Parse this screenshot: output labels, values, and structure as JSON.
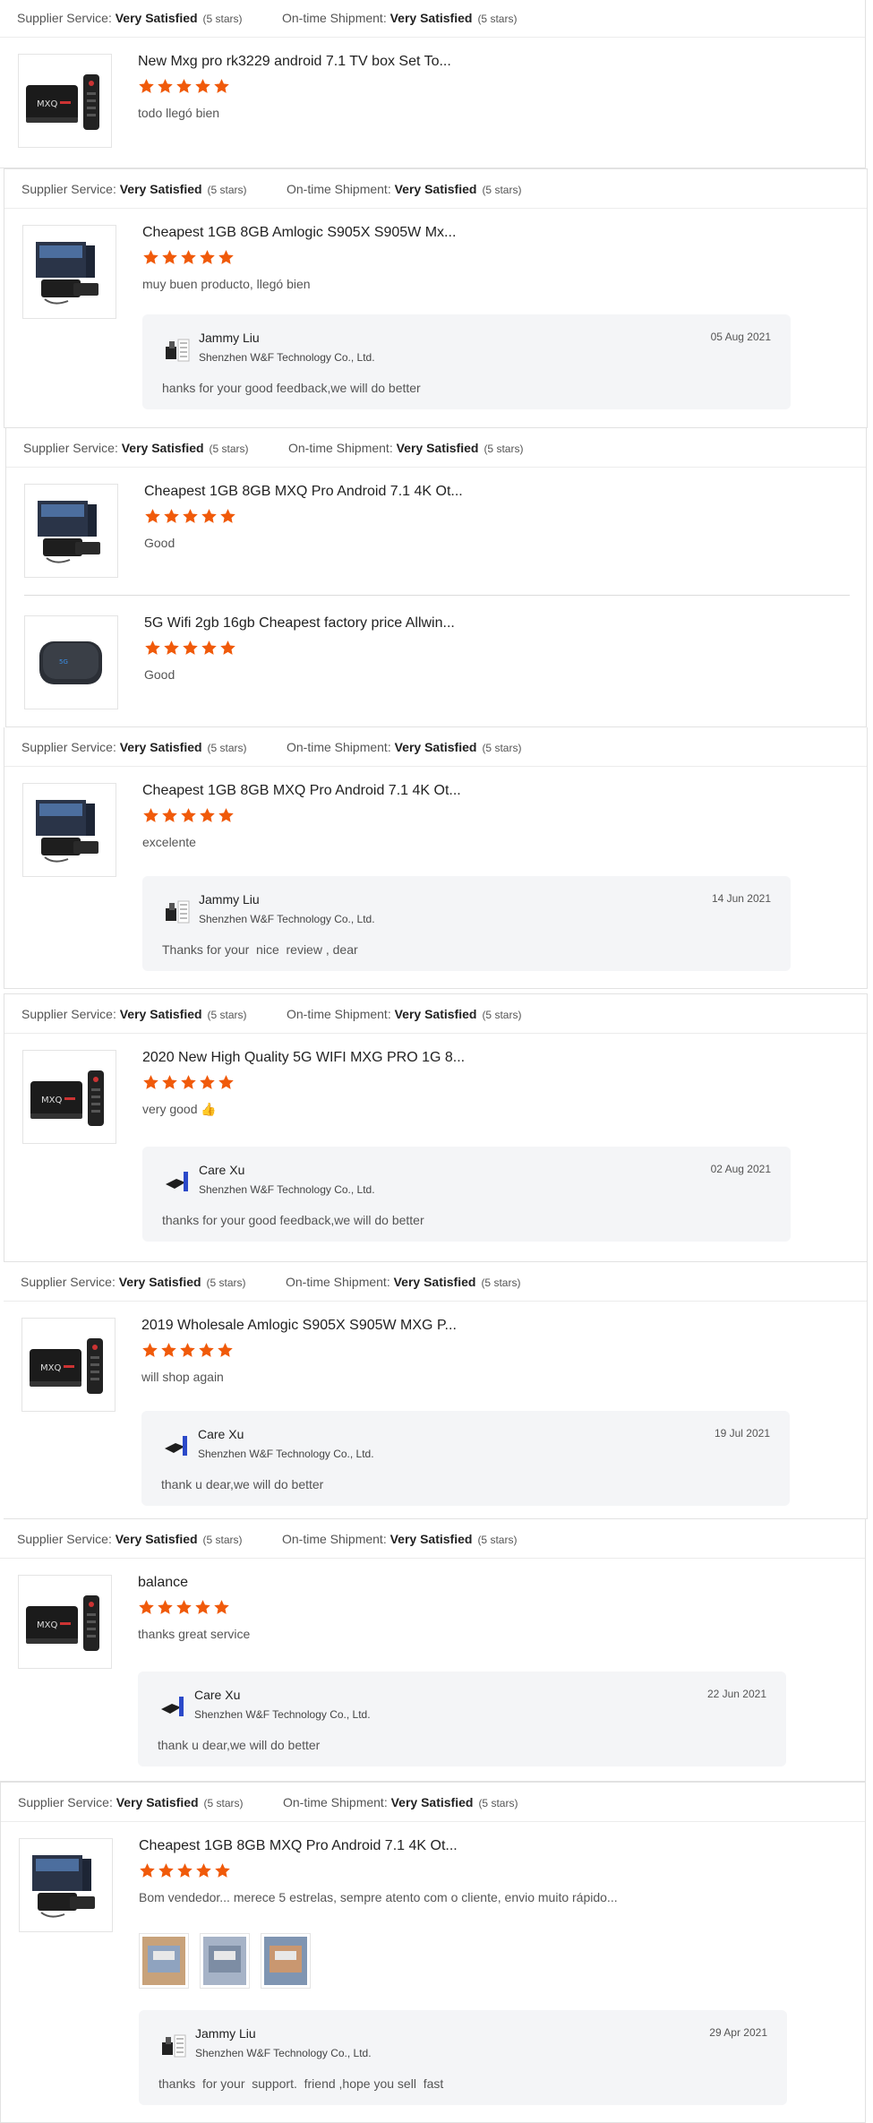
{
  "rating_bar": {
    "supplier_label": "Supplier Service:",
    "shipment_label": "On-time Shipment:",
    "value": "Very Satisfied",
    "stars_text": "(5 stars)"
  },
  "colors": {
    "star": "#f05a0a",
    "border": "#e2e2e2",
    "reply_bg": "#f4f5f7"
  },
  "cards": [
    {
      "products": [
        {
          "title": "New Mxg pro rk3229 android 7.1 TV box Set To...",
          "review": "todo llegó bien",
          "image_icon": "mxq-pro-box-remote"
        }
      ]
    },
    {
      "products": [
        {
          "title": "Cheapest 1GB 8GB Amlogic S905X S905W Mx...",
          "review": "muy buen producto, llegó bien",
          "image_icon": "boxed-tv-box"
        }
      ],
      "reply": {
        "name": "Jammy Liu",
        "company": "Shenzhen W&F Technology Co., Ltd.",
        "date": "05 Aug 2021",
        "text": "hanks for your good feedback,we will do better",
        "avatar_icon": "tv-box-avatar"
      }
    },
    {
      "products": [
        {
          "title": "Cheapest 1GB 8GB MXQ Pro Android 7.1 4K Ot...",
          "review": "Good",
          "image_icon": "boxed-tv-box"
        },
        {
          "title": "5G Wifi 2gb 16gb Cheapest factory price Allwin...",
          "review": "Good",
          "image_icon": "rounded-tv-box"
        }
      ]
    },
    {
      "products": [
        {
          "title": "Cheapest 1GB 8GB MXQ Pro Android 7.1 4K Ot...",
          "review": "excelente",
          "image_icon": "boxed-tv-box"
        }
      ],
      "reply": {
        "name": "Jammy Liu",
        "company": "Shenzhen W&F Technology Co., Ltd.",
        "date": "14 Jun 2021",
        "text": "Thanks for your  nice  review , dear",
        "avatar_icon": "tv-box-avatar"
      }
    },
    {
      "products": [
        {
          "title": "2020 New High Quality 5G WIFI MXG PRO 1G 8...",
          "review": "very good 👍",
          "image_icon": "mxq-pro-box-remote"
        }
      ],
      "reply": {
        "name": "Care Xu",
        "company": "Shenzhen W&F Technology Co., Ltd.",
        "date": "02 Aug 2021",
        "text": "thanks for your good feedback,we will do better",
        "avatar_icon": "tv-box-blue-avatar"
      }
    },
    {
      "products": [
        {
          "title": "2019 Wholesale Amlogic S905X S905W MXG P...",
          "review": "will shop again",
          "image_icon": "mxq-pro-box-remote"
        }
      ],
      "reply": {
        "name": "Care Xu",
        "company": "Shenzhen W&F Technology Co., Ltd.",
        "date": "19 Jul 2021",
        "text": "thank u dear,we will do better",
        "avatar_icon": "tv-box-blue-avatar"
      }
    },
    {
      "products": [
        {
          "title": "balance",
          "review": "thanks great service",
          "image_icon": "mxq-pro-box-remote"
        }
      ],
      "reply": {
        "name": "Care Xu",
        "company": "Shenzhen W&F Technology Co., Ltd.",
        "date": "22 Jun 2021",
        "text": "thank u dear,we will do better",
        "avatar_icon": "tv-box-blue-avatar"
      }
    },
    {
      "products": [
        {
          "title": "Cheapest 1GB 8GB MXQ Pro Android 7.1 4K Ot...",
          "review": "Bom vendedor... merece 5 estrelas, sempre atento com o cliente, envio muito rápido...",
          "image_icon": "boxed-tv-box"
        }
      ],
      "photos": [
        "photo-1",
        "photo-2",
        "photo-3"
      ],
      "reply": {
        "name": "Jammy Liu",
        "company": "Shenzhen W&F Technology Co., Ltd.",
        "date": "29 Apr 2021",
        "text": "thanks  for your  support.  friend ,hope you sell  fast",
        "avatar_icon": "tv-box-avatar"
      }
    }
  ]
}
